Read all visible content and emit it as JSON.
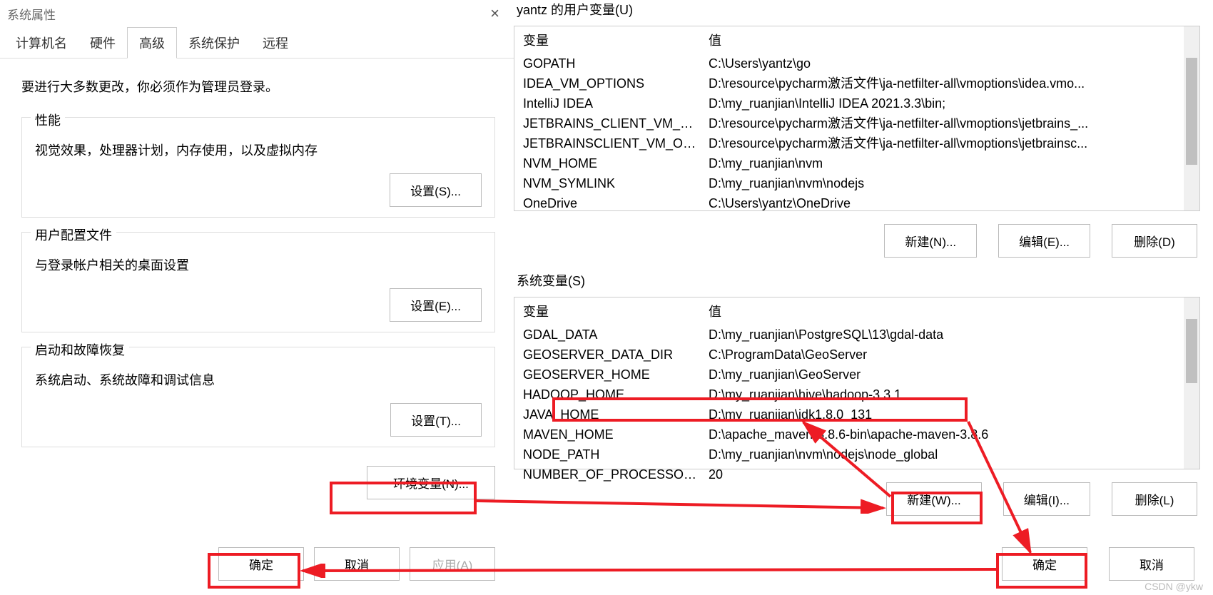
{
  "left": {
    "title": "系统属性",
    "tabs": [
      "计算机名",
      "硬件",
      "高级",
      "系统保护",
      "远程"
    ],
    "active_tab": 2,
    "instruction": "要进行大多数更改，你必须作为管理员登录。",
    "sections": [
      {
        "title": "性能",
        "desc": "视觉效果，处理器计划，内存使用，以及虚拟内存",
        "button": "设置(S)..."
      },
      {
        "title": "用户配置文件",
        "desc": "与登录帐户相关的桌面设置",
        "button": "设置(E)..."
      },
      {
        "title": "启动和故障恢复",
        "desc": "系统启动、系统故障和调试信息",
        "button": "设置(T)..."
      }
    ],
    "env_button": "环境变量(N)...",
    "ok": "确定",
    "cancel": "取消",
    "apply": "应用(A)"
  },
  "right": {
    "user_vars_label": "yantz 的用户变量(U)",
    "headers": {
      "var": "变量",
      "val": "值"
    },
    "user_vars": [
      {
        "var": "GOPATH",
        "val": "C:\\Users\\yantz\\go"
      },
      {
        "var": "IDEA_VM_OPTIONS",
        "val": "D:\\resource\\pycharm激活文件\\ja-netfilter-all\\vmoptions\\idea.vmo..."
      },
      {
        "var": "IntelliJ IDEA",
        "val": "D:\\my_ruanjian\\IntelliJ IDEA 2021.3.3\\bin;"
      },
      {
        "var": "JETBRAINS_CLIENT_VM_OPT...",
        "val": "D:\\resource\\pycharm激活文件\\ja-netfilter-all\\vmoptions\\jetbrains_..."
      },
      {
        "var": "JETBRAINSCLIENT_VM_OPTI...",
        "val": "D:\\resource\\pycharm激活文件\\ja-netfilter-all\\vmoptions\\jetbrainsc..."
      },
      {
        "var": "NVM_HOME",
        "val": "D:\\my_ruanjian\\nvm"
      },
      {
        "var": "NVM_SYMLINK",
        "val": "D:\\my_ruanjian\\nvm\\nodejs"
      },
      {
        "var": "OneDrive",
        "val": "C:\\Users\\yantz\\OneDrive"
      }
    ],
    "user_buttons": {
      "new": "新建(N)...",
      "edit": "编辑(E)...",
      "delete": "删除(D)"
    },
    "sys_vars_label": "系统变量(S)",
    "sys_vars": [
      {
        "var": "GDAL_DATA",
        "val": "D:\\my_ruanjian\\PostgreSQL\\13\\gdal-data"
      },
      {
        "var": "GEOSERVER_DATA_DIR",
        "val": "C:\\ProgramData\\GeoServer"
      },
      {
        "var": "GEOSERVER_HOME",
        "val": "D:\\my_ruanjian\\GeoServer"
      },
      {
        "var": "HADOOP_HOME",
        "val": "D:\\my_ruanjian\\hive\\hadoop-3.3.1"
      },
      {
        "var": "JAVA_HOME",
        "val": "D:\\my_ruanjian\\jdk1.8.0_131"
      },
      {
        "var": "MAVEN_HOME",
        "val": "D:\\apache_maven-3.8.6-bin\\apache-maven-3.8.6"
      },
      {
        "var": "NODE_PATH",
        "val": "D:\\my_ruanjian\\nvm\\nodejs\\node_global"
      },
      {
        "var": "NUMBER_OF_PROCESSORS",
        "val": "20"
      }
    ],
    "sys_buttons": {
      "new": "新建(W)...",
      "edit": "编辑(I)...",
      "delete": "删除(L)"
    },
    "ok": "确定",
    "cancel": "取消"
  },
  "watermark": "CSDN @ykw"
}
